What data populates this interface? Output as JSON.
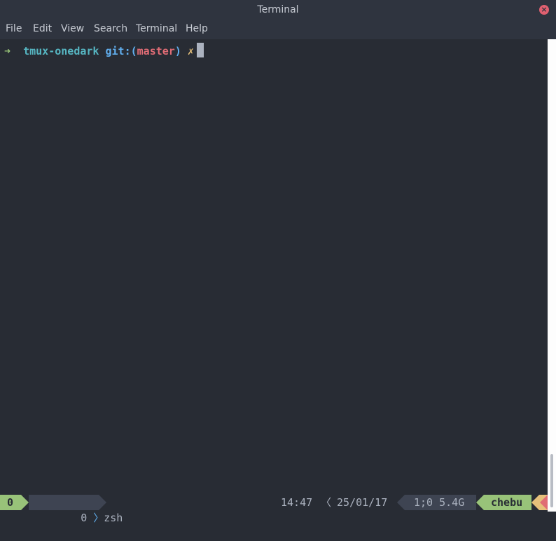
{
  "window": {
    "title": "Terminal"
  },
  "menu": [
    "File",
    "Edit",
    "View",
    "Search",
    "Terminal",
    "Help"
  ],
  "prompt": {
    "arrow": "➜",
    "directory": "tmux-onedark",
    "git_prefix": "git:(",
    "branch": "master",
    "git_suffix": ")",
    "dirty_mark": "✗"
  },
  "statusbar": {
    "session": "0",
    "window_index": "0",
    "window_name": "zsh",
    "time": "14:47",
    "date": "25/01/17",
    "stats": "1;0 5.4G",
    "host": "chebu"
  },
  "colors": {
    "background": "#282c34",
    "green": "#98c379",
    "cyan": "#56b6c2",
    "blue": "#61afef",
    "red": "#e06c75",
    "yellow": "#e5c07b"
  }
}
